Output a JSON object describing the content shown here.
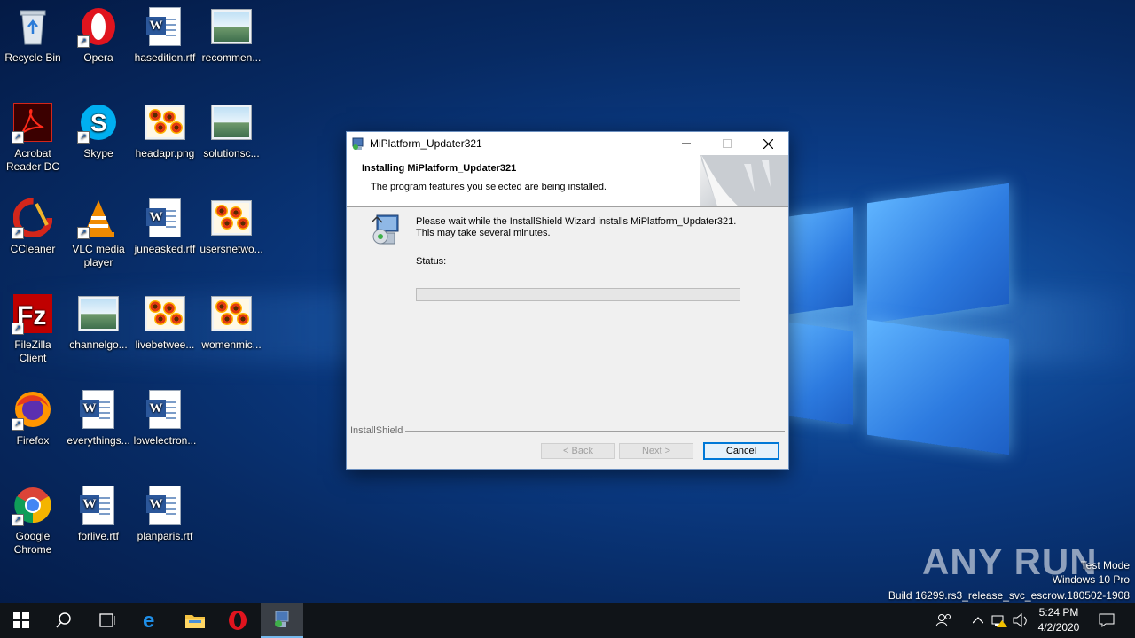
{
  "desktop": {
    "icons": [
      {
        "label": "Recycle Bin",
        "icon": "recycle-bin-icon"
      },
      {
        "label": "Opera",
        "icon": "opera-icon"
      },
      {
        "label": "hasedition.rtf",
        "icon": "word-doc-icon"
      },
      {
        "label": "recommen...",
        "icon": "image-file-icon"
      },
      {
        "label": "Acrobat Reader DC",
        "icon": "acrobat-icon"
      },
      {
        "label": "Skype",
        "icon": "skype-icon"
      },
      {
        "label": "headapr.png",
        "icon": "png-file-icon"
      },
      {
        "label": "solutionsc...",
        "icon": "image-file-icon"
      },
      {
        "label": "CCleaner",
        "icon": "ccleaner-icon"
      },
      {
        "label": "VLC media player",
        "icon": "vlc-icon"
      },
      {
        "label": "juneasked.rtf",
        "icon": "word-doc-icon"
      },
      {
        "label": "usersnetwo...",
        "icon": "png-file-icon"
      },
      {
        "label": "FileZilla Client",
        "icon": "filezilla-icon"
      },
      {
        "label": "channelgo...",
        "icon": "image-file-icon"
      },
      {
        "label": "livebetwee...",
        "icon": "png-file-icon"
      },
      {
        "label": "womenmic...",
        "icon": "png-file-icon"
      },
      {
        "label": "Firefox",
        "icon": "firefox-icon"
      },
      {
        "label": "everythings...",
        "icon": "word-doc-icon"
      },
      {
        "label": "lowelectron...",
        "icon": "word-doc-icon"
      },
      {
        "label": "Google Chrome",
        "icon": "chrome-icon"
      },
      {
        "label": "forlive.rtf",
        "icon": "word-doc-icon"
      },
      {
        "label": "planparis.rtf",
        "icon": "word-doc-icon"
      }
    ]
  },
  "dialog": {
    "window_title": "MiPlatform_Updater321",
    "header_title": "Installing MiPlatform_Updater321",
    "header_subtitle": "The program features you selected are being installed.",
    "message_line1": "Please wait while the InstallShield Wizard installs MiPlatform_Updater321.",
    "message_line2": "This may take several minutes.",
    "status_label": "Status:",
    "progress_fraction": 0,
    "brand": "InstallShield",
    "back_button": "< Back",
    "next_button": "Next >",
    "cancel_button": "Cancel"
  },
  "watermark": {
    "logo": "ANY RUN",
    "mode": "Test Mode",
    "os": "Windows 10 Pro",
    "build": "Build 16299.rs3_release_svc_escrow.180502-1908"
  },
  "taskbar": {
    "time": "5:24 PM",
    "date": "4/2/2020"
  },
  "colors": {
    "accent": "#0078d7",
    "taskbar": "#101418",
    "progress": "#06b025"
  }
}
